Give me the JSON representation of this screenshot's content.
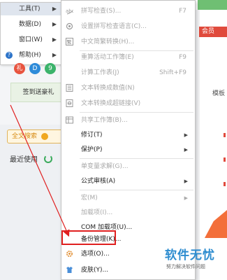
{
  "left_menu": {
    "items": [
      {
        "label": "工具(T)",
        "arrow": "▶"
      },
      {
        "label": "数据(D)",
        "arrow": "▶"
      },
      {
        "label": "窗口(W)",
        "arrow": "▶"
      },
      {
        "label": "帮助(H)",
        "arrow": "▶"
      }
    ]
  },
  "background": {
    "sign_in_button": "签到送豪礼",
    "circle_buttons": [
      "礼",
      "D",
      "9"
    ],
    "search_pill": "全文搜索",
    "recent_label": "最近使用",
    "member_button": "会员",
    "template_label": "模板"
  },
  "dropdown": {
    "items": [
      {
        "label": "拼写检查(S)...",
        "shortcut": "F7",
        "enabled": false,
        "icon": "spellcheck-icon"
      },
      {
        "label": "设置拼写检查语言(C)...",
        "enabled": false,
        "icon": "language-settings-icon"
      },
      {
        "label": "中文简繁转换(H)...",
        "enabled": false,
        "icon": "chinese-convert-icon"
      },
      {
        "label": "重算活动工作簿(E)",
        "shortcut": "F9",
        "enabled": false
      },
      {
        "label": "计算工作表(J)",
        "shortcut": "Shift+F9",
        "enabled": false
      },
      {
        "label": "文本转换成数值(N)",
        "enabled": false,
        "icon": "text-to-number-icon"
      },
      {
        "label": "文本转换成超链接(V)",
        "enabled": false,
        "icon": "text-to-hyperlink-icon"
      },
      {
        "label": "共享工作簿(B)...",
        "enabled": false,
        "icon": "share-workbook-icon"
      },
      {
        "label": "修订(T)",
        "enabled": true,
        "submenu": "▶"
      },
      {
        "label": "保护(P)",
        "enabled": true,
        "submenu": "▶"
      },
      {
        "label": "单变量求解(G)...",
        "enabled": false
      },
      {
        "label": "公式审核(A)",
        "enabled": true,
        "submenu": "▶"
      },
      {
        "label": "宏(M)",
        "enabled": false,
        "submenu": "▶"
      },
      {
        "label": "加载项(I)...",
        "enabled": false
      },
      {
        "label": "COM 加载项(U)...",
        "enabled": true
      },
      {
        "label": "备份管理(K)...",
        "enabled": true
      },
      {
        "label": "选项(O)...",
        "enabled": true,
        "icon": "gear-icon"
      },
      {
        "label": "皮肤(Y)...",
        "enabled": true,
        "icon": "skin-icon"
      }
    ]
  },
  "watermark": {
    "title": "软件无忧",
    "subtitle": "努力解决软件问题"
  },
  "colors": {
    "highlight_box": "#e02020",
    "arrow": "#e02020",
    "watermark": "#2d8ccf"
  }
}
